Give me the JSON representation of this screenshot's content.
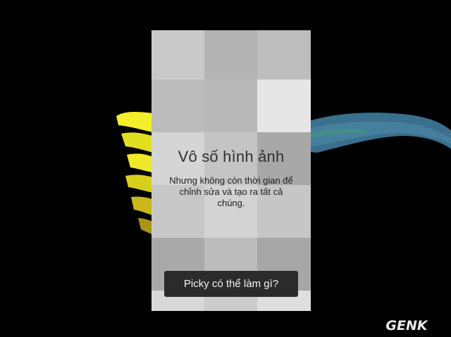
{
  "screen": {
    "heading": "Vô số hình ảnh",
    "subtext_line1": "Nhưng không còn thời gian để",
    "subtext_line2": "chỉnh sửa và tạo ra tất cả chúng.",
    "cta_label": "Picky có thể làm gì?"
  },
  "mosaic": {
    "tile_colors": [
      "#c9c9c9",
      "#b3b3b3",
      "#bdbdbd",
      "#bcbcbc",
      "#b9b9b9",
      "#e6e6e6",
      "#d5d5d5",
      "#c4c4c4",
      "#a8a8a8",
      "#c7c7c7",
      "#d3d3d3",
      "#c6c6c6",
      "#a9a9a9",
      "#bcbcbc",
      "#a7a7a7",
      "#d8d8d8",
      "#cbcbcb",
      "#dedede"
    ]
  },
  "colors": {
    "background": "#000000",
    "flower_petal": "#f1ef2a",
    "stem": "#3d6c87",
    "cta_background": "#2b2b2b"
  },
  "watermark": {
    "text": "GENK"
  }
}
